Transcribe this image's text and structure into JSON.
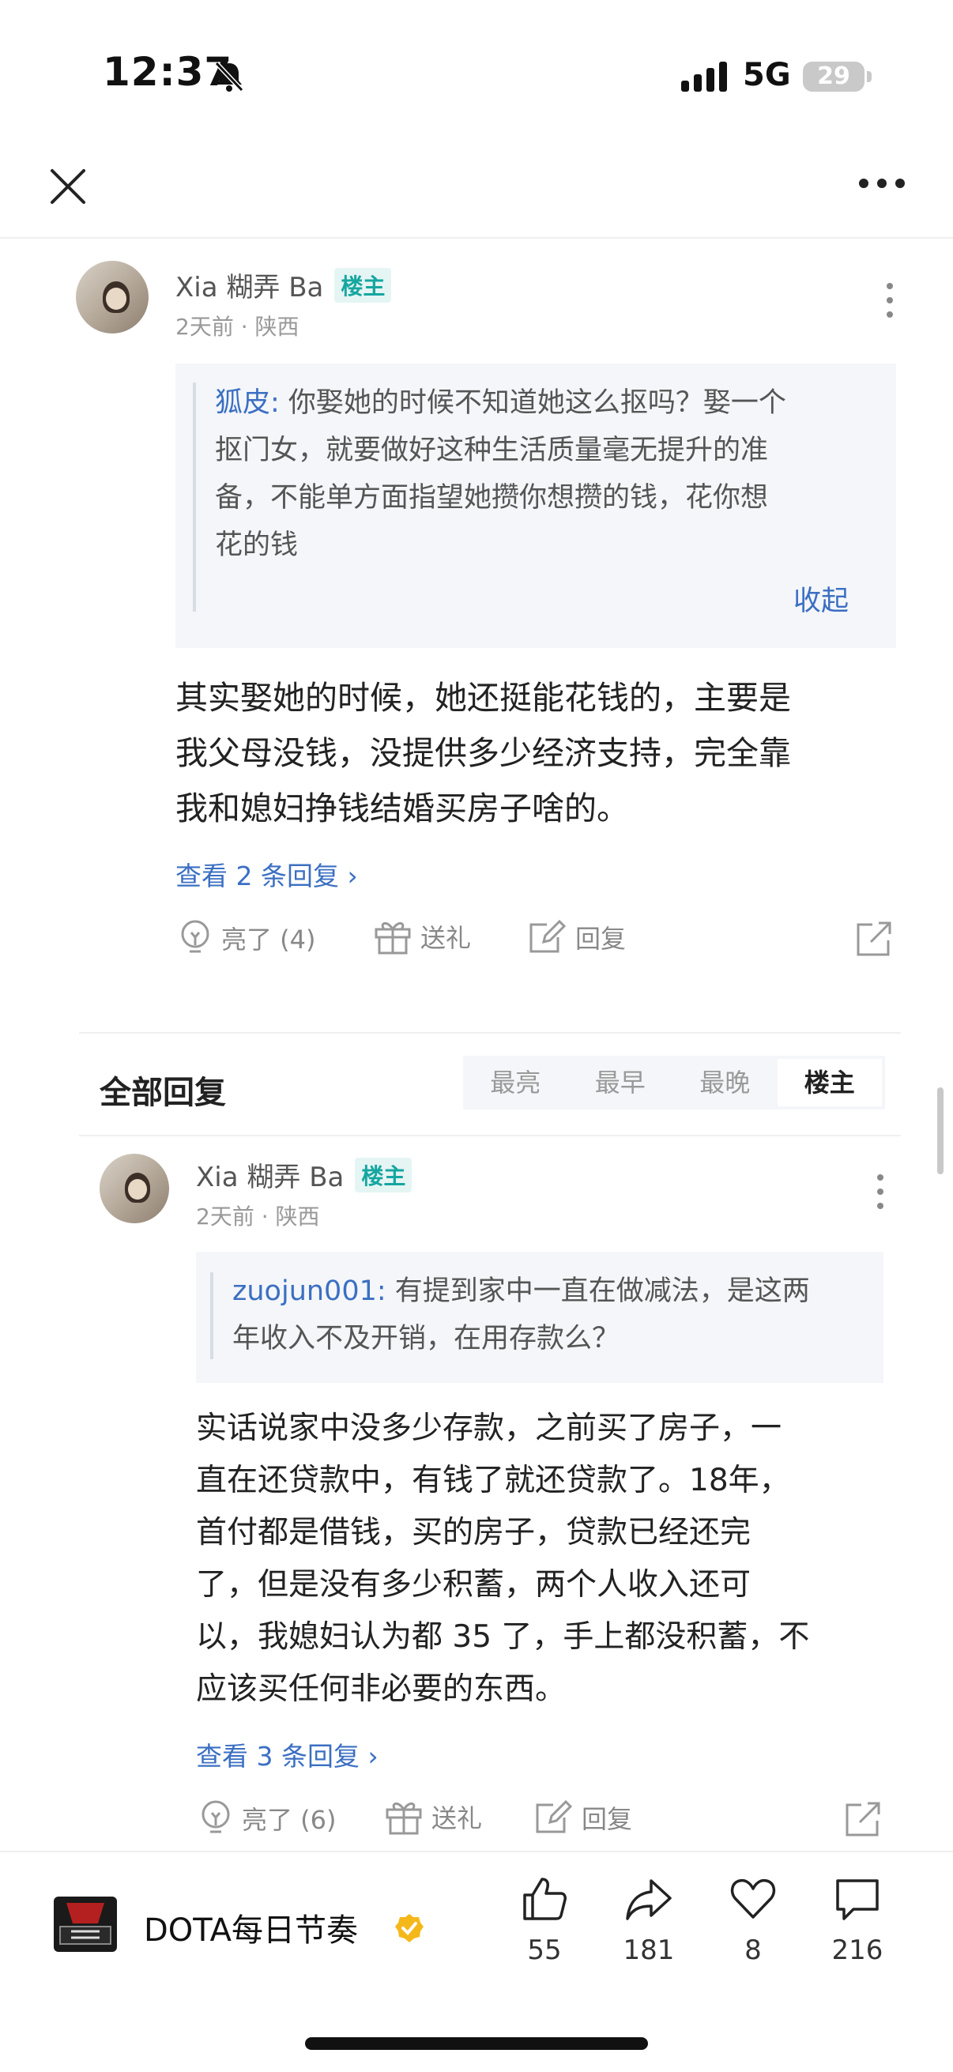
{
  "status_bar": {
    "time": "12:37",
    "network": "5G",
    "battery": "29"
  },
  "comment1": {
    "username": "Xia 糊弄 Ba",
    "badge": "楼主",
    "meta": "2天前 · 陕西",
    "quote_name": "狐皮:",
    "quote_lines": [
      " 你娶她的时候不知道她这么抠吗？娶一个",
      "抠门女，就要做好这种生活质量毫无提升的准",
      "备，不能单方面指望她攒你想攒的钱，花你想",
      "花的钱"
    ],
    "collapse_label": "收起",
    "body_lines": [
      "其实娶她的时候，她还挺能花钱的，主要是",
      "我父母没钱，没提供多少经济支持，完全靠",
      "我和媳妇挣钱结婚买房子啥的。"
    ],
    "view_replies": "查看 2 条回复 ›",
    "actions": {
      "like": "亮了 (4)",
      "gift": "送礼",
      "reply": "回复"
    }
  },
  "all_replies": {
    "title": "全部回复",
    "sort_options": [
      "最亮",
      "最早",
      "最晚",
      "楼主"
    ],
    "active_sort": "楼主"
  },
  "comment2": {
    "username": "Xia 糊弄 Ba",
    "badge": "楼主",
    "meta": "2天前 · 陕西",
    "quote_name": "zuojun001:",
    "quote_lines": [
      " 有提到家中一直在做减法，是这两",
      "年收入不及开销，在用存款么？"
    ],
    "body_lines": [
      "实话说家中没多少存款，之前买了房子，一",
      "直在还贷款中，有钱了就还贷款了。18年，",
      "首付都是借钱，买的房子，贷款已经还完",
      "了，但是没有多少积蓄，两个人收入还可",
      "以，我媳妇认为都 35 了，手上都没积蓄，不",
      "应该买任何非必要的东西。"
    ],
    "view_replies": "查看 3 条回复 ›",
    "actions": {
      "like": "亮了 (6)",
      "gift": "送礼",
      "reply": "回复"
    }
  },
  "bottom_bar": {
    "channel_name": "DOTA每日节奏",
    "likes": "55",
    "shares": "181",
    "favorites": "8",
    "comments": "216"
  }
}
